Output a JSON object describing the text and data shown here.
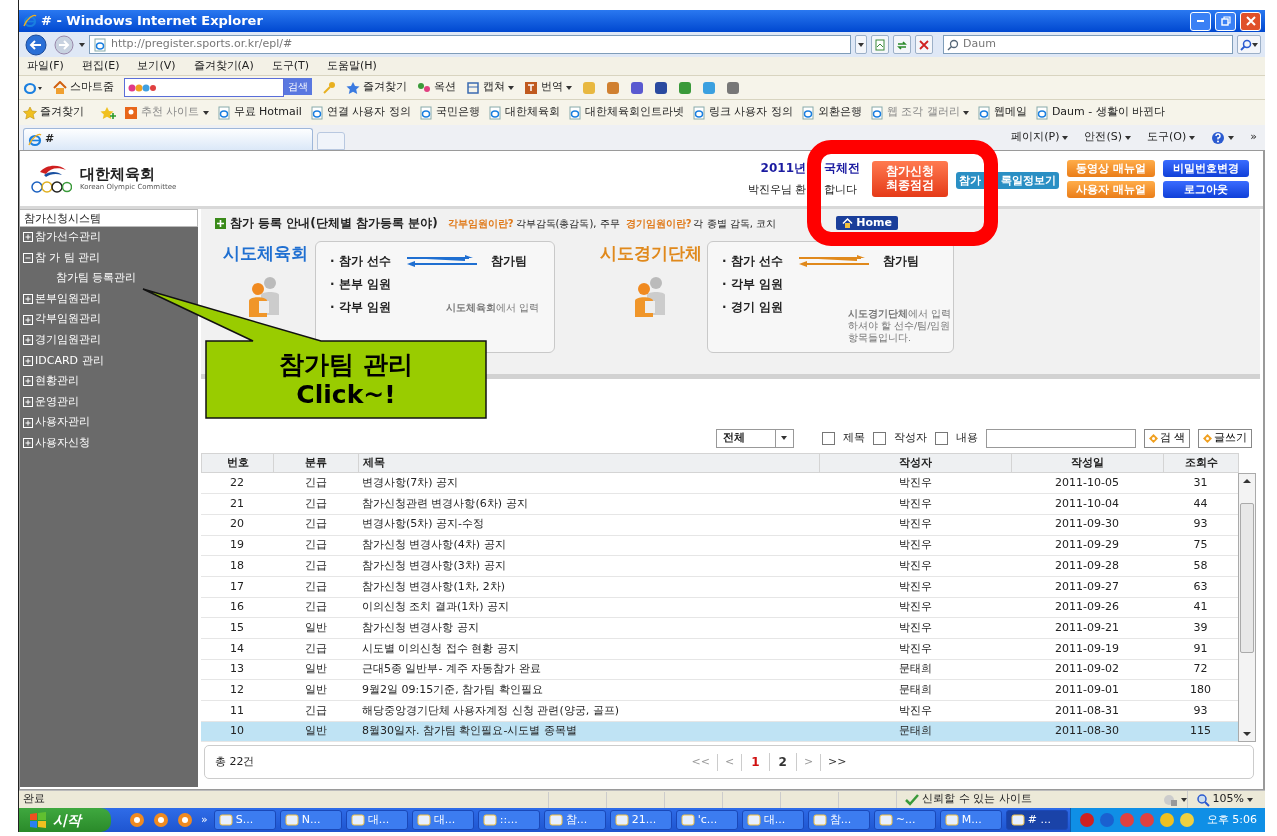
{
  "window": {
    "title": "# - Windows Internet Explorer"
  },
  "address_bar": {
    "url": "http://pregister.sports.or.kr/epl/#"
  },
  "search_box": {
    "placeholder": "Daum"
  },
  "menu": [
    "파일(F)",
    "편집(E)",
    "보기(V)",
    "즐겨찾기(A)",
    "도구(T)",
    "도움말(H)"
  ],
  "toolbar": {
    "home": "스마트줌",
    "search_button": "검색",
    "items": [
      "즐겨찾기",
      "옥션",
      "캡쳐",
      "번역"
    ]
  },
  "favorites_bar": {
    "label": "즐겨찾기",
    "links": [
      {
        "label": "추천 사이트",
        "disabled": true
      },
      {
        "label": "무료 Hotmail",
        "disabled": false
      },
      {
        "label": "연결 사용자 정의",
        "disabled": false
      },
      {
        "label": "국민은행",
        "disabled": false
      },
      {
        "label": "대한체육회",
        "disabled": false
      },
      {
        "label": "대한체육회인트라넷",
        "disabled": false
      },
      {
        "label": "링크 사용자 정의",
        "disabled": false
      },
      {
        "label": "외환은행",
        "disabled": false
      },
      {
        "label": "웹 조각 갤러리",
        "disabled": true
      },
      {
        "label": "웹메일",
        "disabled": false
      },
      {
        "label": "Daum - 생활이 바뀐다",
        "disabled": false
      }
    ]
  },
  "tab": {
    "title": "#"
  },
  "command_bar": {
    "items": [
      "페이지(P)",
      "안전(S)",
      "도구(O)"
    ],
    "overflow": "»"
  },
  "page": {
    "logo": {
      "name": "대한체육회",
      "subtitle": "Korean Olympic Committee"
    },
    "header": {
      "event": [
        "2011년",
        "국체전"
      ],
      "welcome": [
        "박진우님 환",
        "합니다"
      ],
      "final_check_button": [
        "참가신청",
        "최종점검"
      ],
      "schedule_button": [
        "참가",
        "록일정보기"
      ],
      "buttons": [
        {
          "label": "동영상 매뉴얼",
          "kind": "orange"
        },
        {
          "label": "사용자 매뉴얼",
          "kind": "orange"
        },
        {
          "label": "비밀번호변경",
          "kind": "blue"
        },
        {
          "label": "로그아웃",
          "kind": "blue"
        }
      ]
    },
    "sidebar": {
      "title": "참가신청시스템",
      "items": [
        {
          "label": "참가선수관리",
          "expanded": false
        },
        {
          "label": "참 가 팀 관리",
          "expanded": true,
          "children": [
            {
              "label": "참가팀 등록관리"
            }
          ]
        },
        {
          "label": "본부임원관리",
          "expanded": false
        },
        {
          "label": "각부임원관리",
          "expanded": false
        },
        {
          "label": "경기임원관리",
          "expanded": false
        },
        {
          "label": "IDCARD 관리",
          "expanded": false
        },
        {
          "label": "현황관리",
          "expanded": false
        },
        {
          "label": "운영관리",
          "expanded": false
        },
        {
          "label": "사용자관리",
          "expanded": false
        },
        {
          "label": "사용자신청",
          "expanded": false
        }
      ]
    },
    "info": {
      "title": "참가 등록 안내(단체별 참가등록 분야)",
      "notes": [
        {
          "term": "각부임원이란?",
          "text": "각부감독(총감독), 주무"
        },
        {
          "term": "경기임원이란?",
          "text": "각 종별 감독, 코치"
        }
      ],
      "home_button": "Home",
      "groups": [
        {
          "name": "시도체육회",
          "color": "#1f6fd1",
          "items": [
            "· 참가 선수",
            "· 본부 임원",
            "· 각부 임원"
          ],
          "target": "참가팀",
          "note": [
            "**시도체육회**에서 입력"
          ]
        },
        {
          "name": "시도경기단체",
          "color": "#e0891c",
          "items": [
            "· 참가 선수",
            "· 각부 임원",
            "· 경기 임원"
          ],
          "target": "참가팀",
          "note": [
            "**시도경기단체**에서 입력",
            "하셔야 할 선수/팀/임원",
            "항목들입니다."
          ]
        }
      ]
    },
    "callout": [
      "참가팀 관리",
      "Click~!"
    ],
    "board": {
      "filter": {
        "select": "전체",
        "checks": [
          {
            "label": "제목",
            "checked": false
          },
          {
            "label": "작성자",
            "checked": false
          },
          {
            "label": "내용",
            "checked": false
          }
        ],
        "search_button": "검 색",
        "write_button": "글쓰기"
      },
      "columns": [
        "번호",
        "분류",
        "제목",
        "작성자",
        "작성일",
        "조회수"
      ],
      "rows": [
        {
          "cells": [
            "22",
            "긴급",
            "변경사항(7차) 공지",
            "박진우",
            "2011-10-05",
            "31"
          ],
          "selected": false
        },
        {
          "cells": [
            "21",
            "긴급",
            "참가신청관련 변경사항(6차) 공지",
            "박진우",
            "2011-10-04",
            "44"
          ],
          "selected": false
        },
        {
          "cells": [
            "20",
            "긴급",
            "변경사항(5차) 공지-수정",
            "박진우",
            "2011-09-30",
            "93"
          ],
          "selected": false
        },
        {
          "cells": [
            "19",
            "긴급",
            "참가신청 변경사항(4차) 공지",
            "박진우",
            "2011-09-29",
            "75"
          ],
          "selected": false
        },
        {
          "cells": [
            "18",
            "긴급",
            "참가신청 변경사항(3차) 공지",
            "박진우",
            "2011-09-28",
            "58"
          ],
          "selected": false
        },
        {
          "cells": [
            "17",
            "긴급",
            "참가신청 변경사항(1차, 2차)",
            "박진우",
            "2011-09-27",
            "63"
          ],
          "selected": false
        },
        {
          "cells": [
            "16",
            "긴급",
            "이의신청 조치 결과(1차) 공지",
            "박진우",
            "2011-09-26",
            "41"
          ],
          "selected": false
        },
        {
          "cells": [
            "15",
            "일반",
            "참가신청 변경사항 공지",
            "박진우",
            "2011-09-21",
            "39"
          ],
          "selected": false
        },
        {
          "cells": [
            "14",
            "긴급",
            "시도별 이의신청 접수 현황 공지",
            "박진우",
            "2011-09-19",
            "91"
          ],
          "selected": false
        },
        {
          "cells": [
            "13",
            "일반",
            "근대5종 일반부- 계주 자동참가 완료",
            "문태희",
            "2011-09-02",
            "72"
          ],
          "selected": false
        },
        {
          "cells": [
            "12",
            "일반",
            "9월2일 09:15기준, 참가팀 확인필요",
            "문태희",
            "2011-09-01",
            "180"
          ],
          "selected": false
        },
        {
          "cells": [
            "11",
            "긴급",
            "해당중앙경기단체 사용자계정 신청 관련(양궁, 골프)",
            "박진우",
            "2011-08-31",
            "93"
          ],
          "selected": false
        },
        {
          "cells": [
            "10",
            "일반",
            "8월30일자. 참가팀 확인필요-시도별 종목별",
            "문태희",
            "2011-08-30",
            "115"
          ],
          "selected": true
        }
      ],
      "total": "총 22건",
      "pagination": {
        "first": {
          "label": "<<",
          "disabled": true
        },
        "prev": {
          "label": "<",
          "disabled": true
        },
        "pages": [
          {
            "label": "1",
            "selected": true
          },
          {
            "label": "2",
            "selected": false
          }
        ],
        "next": {
          "label": ">",
          "disabled": true
        },
        "last": {
          "label": ">>",
          "disabled": false
        }
      }
    }
  },
  "status_bar": {
    "text": "완료",
    "zone": "신뢰할 수 있는 사이트",
    "zoom": "105%"
  },
  "taskbar": {
    "start": "시작",
    "overflow": "»",
    "tasks": [
      {
        "label": "S...",
        "selected": false
      },
      {
        "label": "N...",
        "selected": false
      },
      {
        "label": "대...",
        "selected": false
      },
      {
        "label": "대...",
        "selected": false
      },
      {
        "label": "::...",
        "selected": false
      },
      {
        "label": "참...",
        "selected": false
      },
      {
        "label": "21...",
        "selected": false
      },
      {
        "label": "'c...",
        "selected": false
      },
      {
        "label": "대...",
        "selected": false
      },
      {
        "label": "참...",
        "selected": false
      },
      {
        "label": "~...",
        "selected": false
      },
      {
        "label": "M...",
        "selected": false
      },
      {
        "label": "# ...",
        "selected": true
      }
    ],
    "clock": "오후 5:06"
  }
}
